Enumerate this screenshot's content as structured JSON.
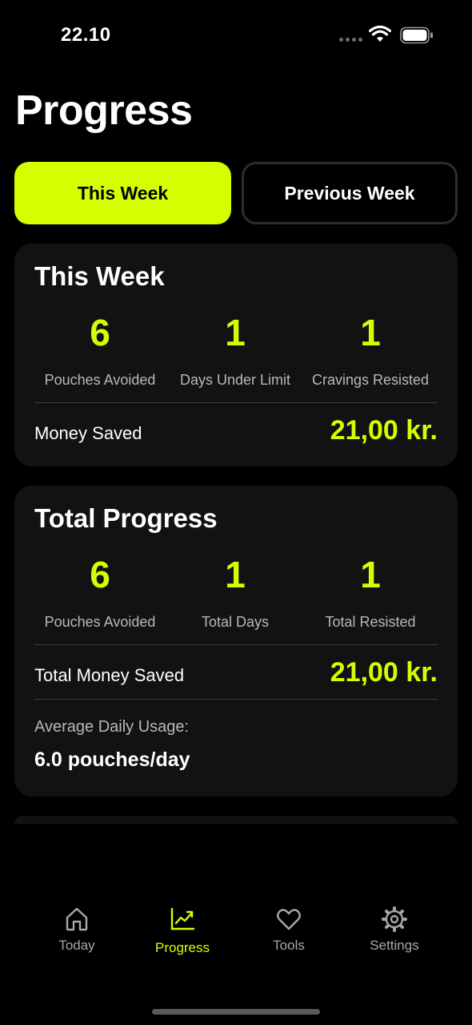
{
  "status_bar": {
    "time": "22.10"
  },
  "page": {
    "title": "Progress"
  },
  "tabs": [
    {
      "label": "This Week",
      "active": true
    },
    {
      "label": "Previous Week",
      "active": false
    }
  ],
  "this_week": {
    "title": "This Week",
    "stats": [
      {
        "value": "6",
        "label": "Pouches Avoided"
      },
      {
        "value": "1",
        "label": "Days Under Limit"
      },
      {
        "value": "1",
        "label": "Cravings Resisted"
      }
    ],
    "money_label": "Money Saved",
    "money_value": "21,00 kr."
  },
  "total_progress": {
    "title": "Total Progress",
    "stats": [
      {
        "value": "6",
        "label": "Pouches Avoided"
      },
      {
        "value": "1",
        "label": "Total Days"
      },
      {
        "value": "1",
        "label": "Total Resisted"
      }
    ],
    "money_label": "Total Money Saved",
    "money_value": "21,00 kr.",
    "avg_label": "Average Daily Usage:",
    "avg_value": "6.0 pouches/day"
  },
  "tab_bar": {
    "items": [
      {
        "label": "Today",
        "icon": "home-icon",
        "active": false
      },
      {
        "label": "Progress",
        "icon": "chart-icon",
        "active": true
      },
      {
        "label": "Tools",
        "icon": "heart-icon",
        "active": false
      },
      {
        "label": "Settings",
        "icon": "gear-icon",
        "active": false
      }
    ]
  },
  "colors": {
    "accent": "#d4ff00",
    "background": "#000000",
    "card": "#121212",
    "muted_text": "#b8b8b8"
  }
}
